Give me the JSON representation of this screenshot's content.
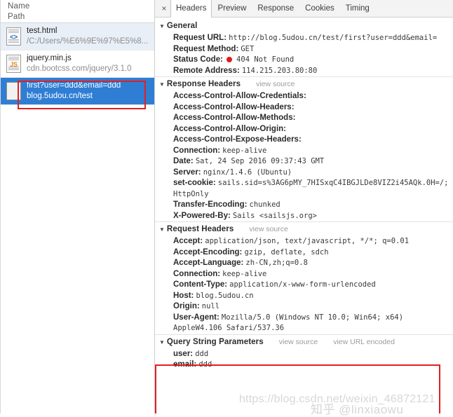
{
  "left_panel": {
    "header": {
      "name_col": "Name",
      "path_col": "Path"
    },
    "requests": [
      {
        "name": "test.html",
        "path": "/C:/Users/%E6%9E%97%E5%8...",
        "icon": "html-file-icon",
        "icon_badge": "<>",
        "state": "alt"
      },
      {
        "name": "jquery.min.js",
        "path": "cdn.bootcss.com/jquery/3.1.0",
        "icon": "js-file-icon",
        "icon_badge": "JS",
        "state": "plain"
      },
      {
        "name": "first?user=ddd&email=ddd",
        "path": "blog.5udou.cn/test",
        "icon": "blank-file-icon",
        "icon_badge": "",
        "state": "selected"
      }
    ]
  },
  "right_panel": {
    "close_label": "×",
    "tabs": [
      {
        "label": "Headers",
        "active": true
      },
      {
        "label": "Preview",
        "active": false
      },
      {
        "label": "Response",
        "active": false
      },
      {
        "label": "Cookies",
        "active": false
      },
      {
        "label": "Timing",
        "active": false
      }
    ],
    "sections": [
      {
        "title": "General",
        "view_source": "",
        "view_url_encoded": "",
        "rows": [
          {
            "key": "Request URL:",
            "value": "http://blog.5udou.cn/test/first?user=ddd&email="
          },
          {
            "key": "Request Method:",
            "value": "GET"
          },
          {
            "key": "Status Code:",
            "value": "404 Not Found",
            "has_status_dot": true
          },
          {
            "key": "Remote Address:",
            "value": "114.215.203.80:80"
          }
        ]
      },
      {
        "title": "Response Headers",
        "view_source": "view source",
        "view_url_encoded": "",
        "rows": [
          {
            "key": "Access-Control-Allow-Credentials:",
            "value": ""
          },
          {
            "key": "Access-Control-Allow-Headers:",
            "value": ""
          },
          {
            "key": "Access-Control-Allow-Methods:",
            "value": ""
          },
          {
            "key": "Access-Control-Allow-Origin:",
            "value": ""
          },
          {
            "key": "Access-Control-Expose-Headers:",
            "value": ""
          },
          {
            "key": "Connection:",
            "value": "keep-alive"
          },
          {
            "key": "Date:",
            "value": "Sat, 24 Sep 2016 09:37:43 GMT"
          },
          {
            "key": "Server:",
            "value": "nginx/1.4.6 (Ubuntu)"
          },
          {
            "key": "set-cookie:",
            "value": "sails.sid=s%3AG6pMY_7HISxqC4IBGJLDe8VIZ2i45AQk.0H=/; HttpOnly",
            "wrap": true
          },
          {
            "key": "Transfer-Encoding:",
            "value": "chunked"
          },
          {
            "key": "X-Powered-By:",
            "value": "Sails <sailsjs.org>"
          }
        ]
      },
      {
        "title": "Request Headers",
        "view_source": "view source",
        "view_url_encoded": "",
        "rows": [
          {
            "key": "Accept:",
            "value": "application/json, text/javascript, */*; q=0.01"
          },
          {
            "key": "Accept-Encoding:",
            "value": "gzip, deflate, sdch"
          },
          {
            "key": "Accept-Language:",
            "value": "zh-CN,zh;q=0.8"
          },
          {
            "key": "Connection:",
            "value": "keep-alive"
          },
          {
            "key": "Content-Type:",
            "value": "application/x-www-form-urlencoded"
          },
          {
            "key": "Host:",
            "value": "blog.5udou.cn"
          },
          {
            "key": "Origin:",
            "value": "null"
          },
          {
            "key": "User-Agent:",
            "value": "Mozilla/5.0 (Windows NT 10.0; Win64; x64) AppleW4.106 Safari/537.36",
            "wrap": true
          }
        ]
      },
      {
        "title": "Query String Parameters",
        "view_source": "view source",
        "view_url_encoded": "view URL encoded",
        "rows": [
          {
            "key": "user:",
            "value": "ddd"
          },
          {
            "key": "email:",
            "value": "ddd"
          }
        ]
      }
    ]
  },
  "annotations": {
    "highlight_color": "#e02020",
    "selected_row_color": "#2f7ed4",
    "status_error_color": "#e01b1b"
  },
  "watermarks": {
    "csdn": "https://blog.csdn.net/weixin_46872121",
    "zhihu": "知乎 @linxiaowu"
  }
}
